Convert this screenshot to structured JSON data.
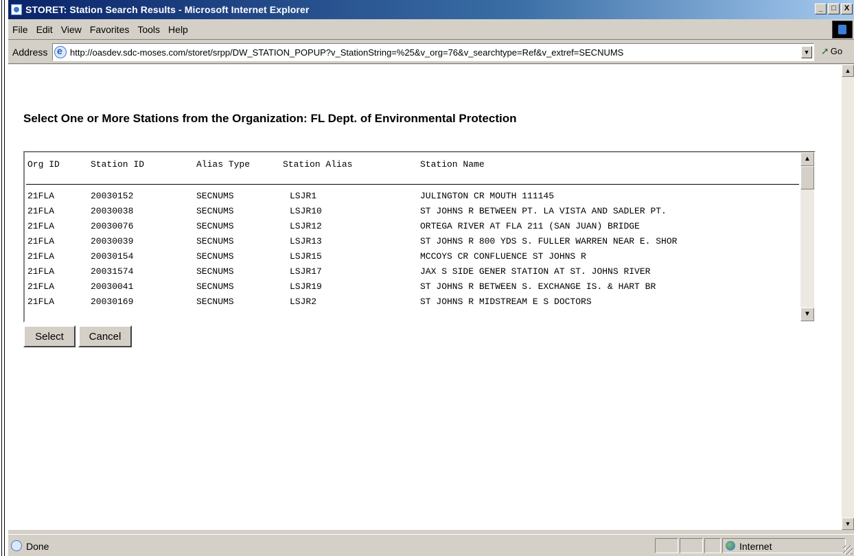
{
  "window": {
    "title": "STORET: Station Search Results - Microsoft Internet Explorer",
    "min_label": "_",
    "max_label": "□",
    "close_label": "X"
  },
  "menu": [
    "File",
    "Edit",
    "View",
    "Favorites",
    "Tools",
    "Help"
  ],
  "address": {
    "label": "Address",
    "url": "http://oasdev.sdc-moses.com/storet/srpp/DW_STATION_POPUP?v_StationString=%25&v_org=76&v_searchtype=Ref&v_extref=SECNUMS",
    "go_label": "Go"
  },
  "page": {
    "heading": "Select One or More Stations from the Organization: FL Dept. of Environmental Protection"
  },
  "table": {
    "columns": [
      "Org ID",
      "Station ID",
      "Alias Type",
      "Station Alias",
      "Station Name"
    ],
    "rows": [
      [
        "21FLA",
        "20030152",
        "SECNUMS",
        "LSJR1",
        "JULINGTON CR MOUTH 111145"
      ],
      [
        "21FLA",
        "20030038",
        "SECNUMS",
        "LSJR10",
        "ST JOHNS R BETWEEN PT. LA VISTA AND SADLER PT."
      ],
      [
        "21FLA",
        "20030076",
        "SECNUMS",
        "LSJR12",
        "ORTEGA RIVER AT FLA 211 (SAN JUAN) BRIDGE"
      ],
      [
        "21FLA",
        "20030039",
        "SECNUMS",
        "LSJR13",
        "ST JOHNS R 800 YDS S. FULLER WARREN NEAR E. SHOR"
      ],
      [
        "21FLA",
        "20030154",
        "SECNUMS",
        "LSJR15",
        "MCCOYS CR CONFLUENCE ST JOHNS R"
      ],
      [
        "21FLA",
        "20031574",
        "SECNUMS",
        "LSJR17",
        "JAX S SIDE GENER STATION AT ST. JOHNS RIVER"
      ],
      [
        "21FLA",
        "20030041",
        "SECNUMS",
        "LSJR19",
        "ST JOHNS R BETWEEN S. EXCHANGE IS. & HART BR"
      ],
      [
        "21FLA",
        "20030169",
        "SECNUMS",
        "LSJR2",
        "ST JOHNS R MIDSTREAM E S DOCTORS"
      ]
    ]
  },
  "buttons": {
    "select": "Select",
    "cancel": "Cancel"
  },
  "status": {
    "text": "Done",
    "zone": "Internet"
  }
}
